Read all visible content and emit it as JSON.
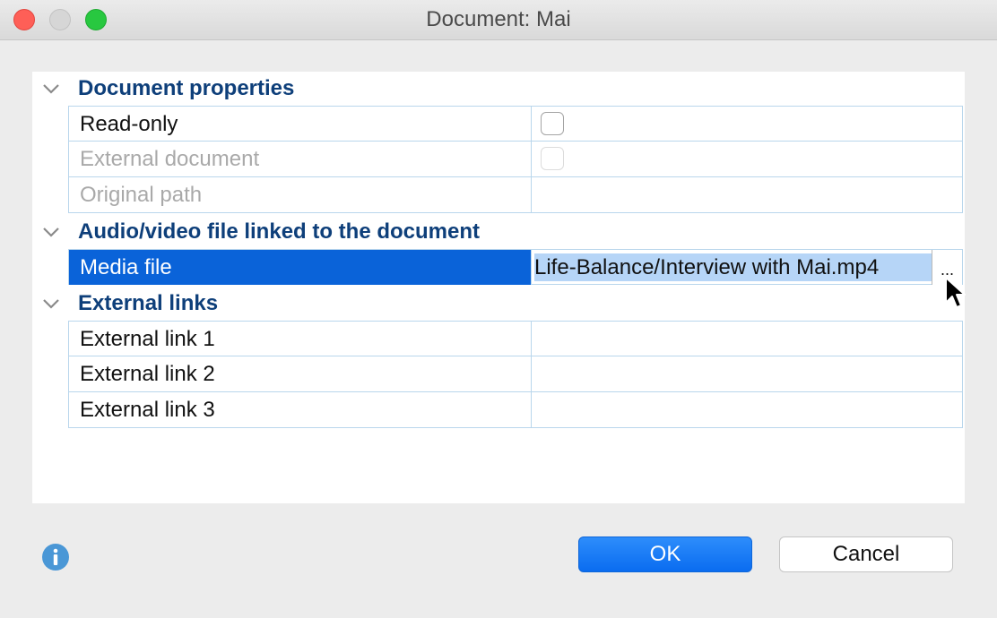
{
  "window": {
    "title": "Document:  Mai"
  },
  "sections": {
    "document_properties": {
      "title": "Document properties",
      "rows": [
        {
          "label": "Read-only",
          "value": "",
          "type": "checkbox",
          "checked": false,
          "enabled": true
        },
        {
          "label": "External document",
          "value": "",
          "type": "checkbox",
          "checked": false,
          "enabled": false
        },
        {
          "label": "Original path",
          "value": "",
          "type": "text",
          "enabled": false
        }
      ]
    },
    "media": {
      "title": "Audio/video file linked to the document",
      "rows": [
        {
          "label": "Media file",
          "value": "Life-Balance/Interview with Mai.mp4",
          "browse_label": "...",
          "selected": true
        }
      ]
    },
    "external_links": {
      "title": "External links",
      "rows": [
        {
          "label": "External link 1",
          "value": ""
        },
        {
          "label": "External link 2",
          "value": ""
        },
        {
          "label": "External link 3",
          "value": ""
        }
      ]
    }
  },
  "buttons": {
    "ok": "OK",
    "cancel": "Cancel"
  },
  "icons": {
    "section_toggle": "chevron-down-icon",
    "info": "info-icon",
    "cursor": "mouse-pointer-icon"
  },
  "colors": {
    "section_title": "#0e3f7a",
    "selection": "#0a63d9",
    "value_highlight": "#b6d5f7",
    "grid_line": "#b9d6ec",
    "ok_button": "#0a6cf0"
  }
}
